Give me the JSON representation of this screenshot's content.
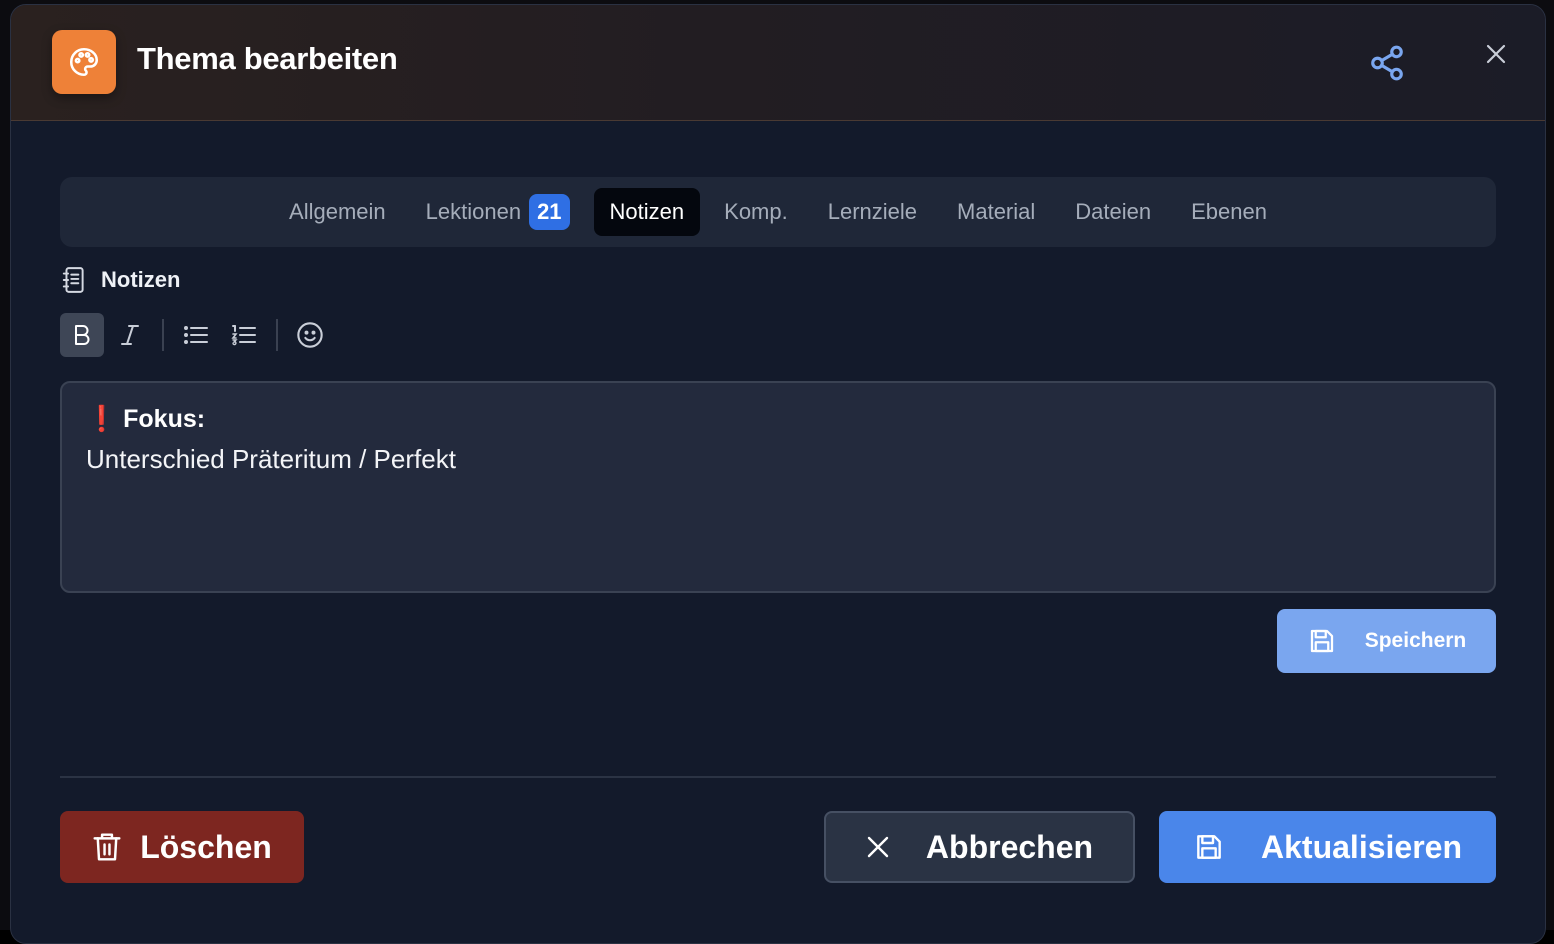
{
  "dialog": {
    "title": "Thema bearbeiten",
    "header_icon": "palette-icon",
    "accent_color": "#ee8138"
  },
  "tabs": [
    {
      "label": "Allgemein",
      "active": false
    },
    {
      "label": "Lektionen",
      "badge": "21",
      "active": false
    },
    {
      "label": "Notizen",
      "active": true
    },
    {
      "label": "Komp.",
      "active": false
    },
    {
      "label": "Lernziele",
      "active": false
    },
    {
      "label": "Material",
      "active": false
    },
    {
      "label": "Dateien",
      "active": false
    },
    {
      "label": "Ebenen",
      "active": false
    }
  ],
  "notes": {
    "section_label": "Notizen",
    "toolbar": [
      "bold-icon",
      "italic-icon",
      "bullet-list-icon",
      "numbered-list-icon",
      "emoji-icon"
    ],
    "content": {
      "line1_marker": "❗",
      "line1_text": "Fokus:",
      "line2_text": "Unterschied Präteritum / Perfekt"
    },
    "save_label": "Speichern"
  },
  "footer": {
    "delete_label": "Löschen",
    "cancel_label": "Abbrechen",
    "update_label": "Aktualisieren"
  },
  "colors": {
    "primary": "#4a86ea",
    "danger": "#7d2620",
    "badge": "#2f6fe4"
  }
}
